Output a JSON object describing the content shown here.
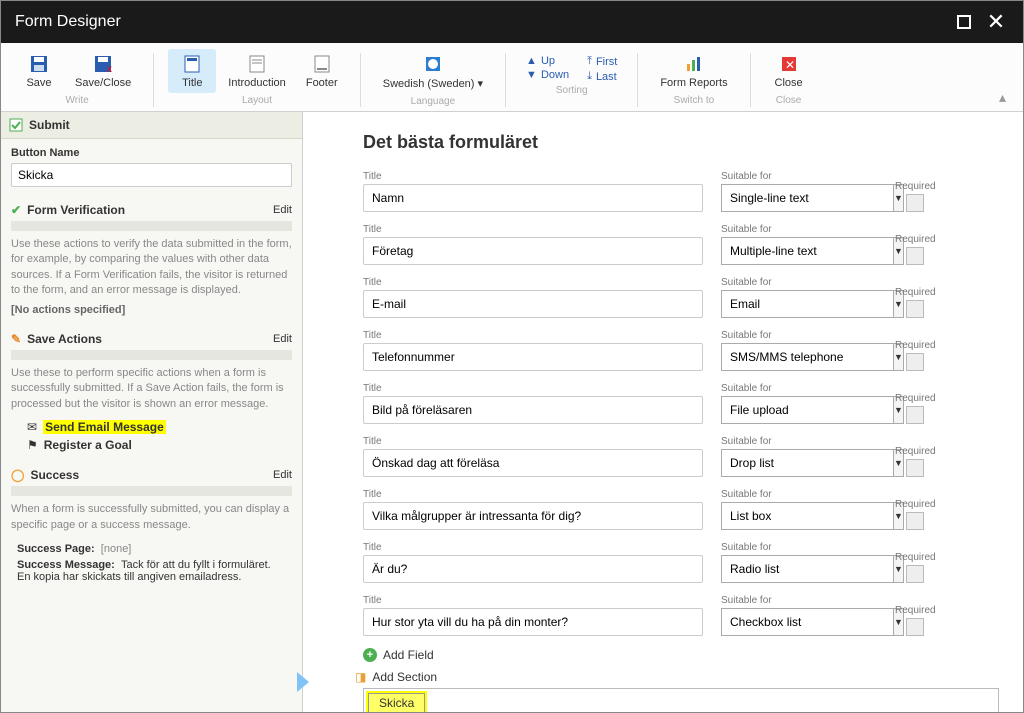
{
  "window": {
    "title": "Form Designer"
  },
  "ribbon": {
    "write": {
      "save": "Save",
      "saveClose": "Save/Close",
      "group": "Write"
    },
    "layout": {
      "title": "Title",
      "intro": "Introduction",
      "footer": "Footer",
      "group": "Layout"
    },
    "language": {
      "value": "Swedish (Sweden)",
      "group": "Language"
    },
    "sorting": {
      "up": "Up",
      "down": "Down",
      "first": "First",
      "last": "Last",
      "group": "Sorting"
    },
    "switch": {
      "formReports": "Form Reports",
      "group": "Switch to"
    },
    "close": {
      "close": "Close",
      "group": "Close"
    }
  },
  "sidebar": {
    "submitHeader": "Submit",
    "buttonNameLabel": "Button Name",
    "buttonNameValue": "Skicka",
    "formVerification": {
      "title": "Form Verification",
      "edit": "Edit",
      "desc": "Use these actions to verify the data submitted in the form, for example, by comparing the values with other data sources. If a Form Verification fails, the visitor is returned to the form, and an error message is displayed.",
      "none": "[No actions specified]"
    },
    "saveActions": {
      "title": "Save Actions",
      "edit": "Edit",
      "desc": "Use these to perform specific actions when a form is successfully submitted. If a Save Action fails, the form is processed but the visitor is shown an error message.",
      "item1": "Send Email Message",
      "item2": "Register a Goal"
    },
    "success": {
      "title": "Success",
      "edit": "Edit",
      "desc": "When a form is successfully submitted, you can display a specific page or a success message.",
      "pageLabel": "Success Page:",
      "pageValue": "[none]",
      "msgLabel": "Success Message:",
      "msgValue": "Tack för att du fyllt i formuläret. En kopia har skickats till angiven emailadress."
    }
  },
  "main": {
    "heading": "Det bästa formuläret",
    "titleLabel": "Title",
    "suitableLabel": "Suitable for",
    "requiredLabel": "Required",
    "fields": [
      {
        "title": "Namn",
        "type": "Single-line text"
      },
      {
        "title": "Företag",
        "type": "Multiple-line text"
      },
      {
        "title": "E-mail",
        "type": "Email"
      },
      {
        "title": "Telefonnummer",
        "type": "SMS/MMS telephone"
      },
      {
        "title": "Bild på föreläsaren",
        "type": "File upload"
      },
      {
        "title": "Önskad dag att föreläsa",
        "type": "Drop list"
      },
      {
        "title": "Vilka målgrupper är intressanta för dig?",
        "type": "List box"
      },
      {
        "title": "Är du?",
        "type": "Radio list"
      },
      {
        "title": "Hur stor yta vill du ha på din monter?",
        "type": "Checkbox list"
      }
    ],
    "addField": "Add Field",
    "addSection": "Add Section",
    "submitLabel": "Skicka"
  }
}
